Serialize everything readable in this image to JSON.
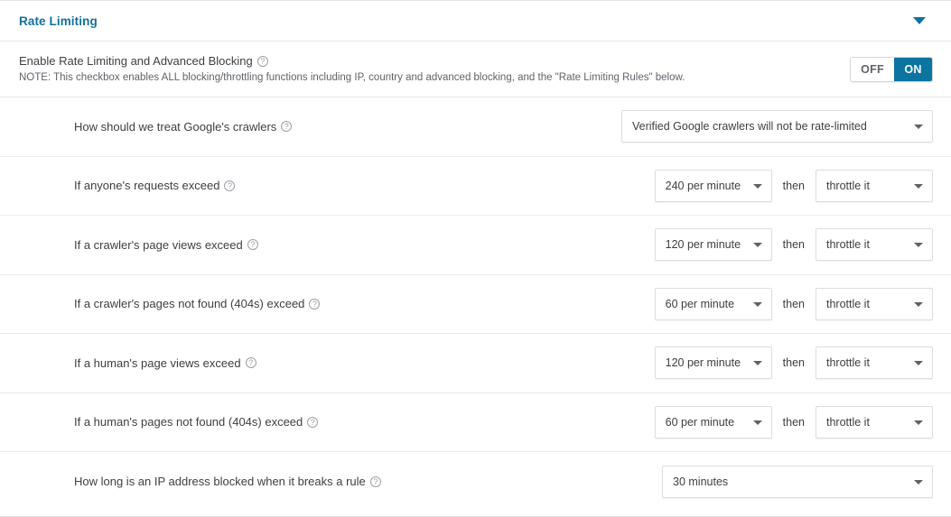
{
  "header": {
    "title": "Rate Limiting",
    "collapse_icon": "chevron-down-icon"
  },
  "enable": {
    "title": "Enable Rate Limiting and Advanced Blocking",
    "help_icon": "?",
    "note": "NOTE: This checkbox enables ALL blocking/throttling functions including IP, country and advanced blocking, and the \"Rate Limiting Rules\" below.",
    "toggle": {
      "off_label": "OFF",
      "on_label": "ON",
      "state": "ON"
    }
  },
  "then_label": "then",
  "help_icon": "?",
  "colors": {
    "accent_blue": "#11709f",
    "toggle_on": "#0b74a0",
    "text": "#3c4043",
    "muted": "#5f6368",
    "border": "#ebebeb"
  },
  "rows": [
    {
      "label": "How should we treat Google's crawlers",
      "primary_value": "Verified Google crawlers will not be rate-limited",
      "has_then": false,
      "secondary_value": ""
    },
    {
      "label": "If anyone's requests exceed",
      "primary_value": "240 per minute",
      "has_then": true,
      "secondary_value": "throttle it"
    },
    {
      "label": "If a crawler's page views exceed",
      "primary_value": "120 per minute",
      "has_then": true,
      "secondary_value": "throttle it"
    },
    {
      "label": "If a crawler's pages not found (404s) exceed",
      "primary_value": "60 per minute",
      "has_then": true,
      "secondary_value": "throttle it"
    },
    {
      "label": "If a human's page views exceed",
      "primary_value": "120 per minute",
      "has_then": true,
      "secondary_value": "throttle it"
    },
    {
      "label": "If a human's pages not found (404s) exceed",
      "primary_value": "60 per minute",
      "has_then": true,
      "secondary_value": "throttle it"
    },
    {
      "label": "How long is an IP address blocked when it breaks a rule",
      "primary_value": "30 minutes",
      "has_then": false,
      "secondary_value": ""
    }
  ]
}
